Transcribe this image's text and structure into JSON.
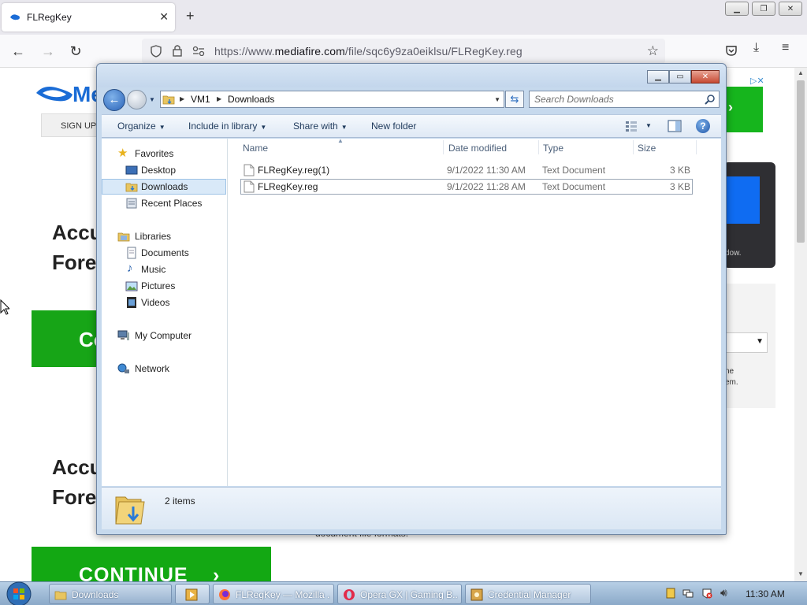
{
  "browser": {
    "tab_title": "FLRegKey",
    "url_prefix": "https://www.",
    "url_domain": "mediafire.com",
    "url_path": "/file/sqc6y9za0eiklsu/FLRegKey.reg"
  },
  "page": {
    "logo_text": "Me",
    "signup": "SIGN UP",
    "heading1_line1": "Accu",
    "heading1_line2": "Fore",
    "green_letter": "Co",
    "heading2_line1": "Accu",
    "heading2_line2": "Fore",
    "continue_label": "CONTINUE",
    "doc_text": "document file formats.",
    "dark_ad_text": "dow.",
    "side_text_1": "ne",
    "side_text_2": "em."
  },
  "explorer": {
    "breadcrumb": [
      "VM1",
      "Downloads"
    ],
    "search_placeholder": "Search Downloads",
    "toolbar": {
      "organize": "Organize",
      "include_in_library": "Include in library",
      "share_with": "Share with",
      "new_folder": "New folder"
    },
    "nav": {
      "favorites": "Favorites",
      "desktop": "Desktop",
      "downloads": "Downloads",
      "recent_places": "Recent Places",
      "libraries": "Libraries",
      "documents": "Documents",
      "music": "Music",
      "pictures": "Pictures",
      "videos": "Videos",
      "my_computer": "My Computer",
      "network": "Network"
    },
    "columns": {
      "name": "Name",
      "date_modified": "Date modified",
      "type": "Type",
      "size": "Size"
    },
    "files": [
      {
        "name": "FLRegKey.reg(1)",
        "date": "9/1/2022 11:30 AM",
        "type": "Text Document",
        "size": "3 KB"
      },
      {
        "name": "FLRegKey.reg",
        "date": "9/1/2022 11:28 AM",
        "type": "Text Document",
        "size": "3 KB"
      }
    ],
    "status": "2 items"
  },
  "taskbar": {
    "items": [
      {
        "label": "Downloads"
      },
      {
        "label": ""
      },
      {
        "label": "FLRegKey — Mozilla ..."
      },
      {
        "label": "Opera GX | Gaming B..."
      },
      {
        "label": "Credential Manager"
      }
    ],
    "clock": "11:30 AM"
  }
}
